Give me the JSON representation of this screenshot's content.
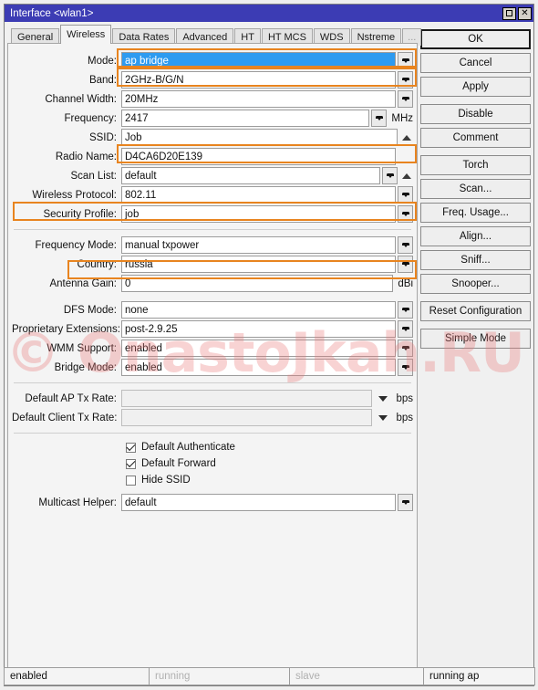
{
  "window": {
    "title": "Interface <wlan1>",
    "maximize_label": "maximize",
    "close_label": "✕",
    "titlebar_color": "#3c3cb4",
    "highlight_color": "#e8841f",
    "selection_color": "#2e9bf0"
  },
  "tabs": [
    {
      "label": "General",
      "active": false
    },
    {
      "label": "Wireless",
      "active": true
    },
    {
      "label": "Data Rates",
      "active": false
    },
    {
      "label": "Advanced",
      "active": false
    },
    {
      "label": "HT",
      "active": false
    },
    {
      "label": "HT MCS",
      "active": false
    },
    {
      "label": "WDS",
      "active": false
    },
    {
      "label": "Nstreme",
      "active": false
    },
    {
      "label": "...",
      "active": false
    }
  ],
  "fields": {
    "mode": {
      "label": "Mode:",
      "value": "ap bridge"
    },
    "band": {
      "label": "Band:",
      "value": "2GHz-B/G/N"
    },
    "channel_width": {
      "label": "Channel Width:",
      "value": "20MHz"
    },
    "frequency": {
      "label": "Frequency:",
      "value": "2417",
      "suffix": "MHz"
    },
    "ssid": {
      "label": "SSID:",
      "value": "Job"
    },
    "radio_name": {
      "label": "Radio Name:",
      "value": "D4CA6D20E139"
    },
    "scan_list": {
      "label": "Scan List:",
      "value": "default"
    },
    "wireless_protocol": {
      "label": "Wireless Protocol:",
      "value": "802.11"
    },
    "security_profile": {
      "label": "Security Profile:",
      "value": "job"
    },
    "frequency_mode": {
      "label": "Frequency Mode:",
      "value": "manual txpower"
    },
    "country": {
      "label": "Country:",
      "value": "russia"
    },
    "antenna_gain": {
      "label": "Antenna Gain:",
      "value": "0",
      "suffix": "dBi"
    },
    "dfs_mode": {
      "label": "DFS Mode:",
      "value": "none"
    },
    "proprietary_extensions": {
      "label": "Proprietary Extensions:",
      "value": "post-2.9.25"
    },
    "wmm_support": {
      "label": "WMM Support:",
      "value": "enabled"
    },
    "bridge_mode": {
      "label": "Bridge Mode:",
      "value": "enabled"
    },
    "default_ap_tx_rate": {
      "label": "Default AP Tx Rate:",
      "value": "",
      "suffix": "bps"
    },
    "default_client_tx_rate": {
      "label": "Default Client Tx Rate:",
      "value": "",
      "suffix": "bps"
    },
    "multicast_helper": {
      "label": "Multicast Helper:",
      "value": "default"
    }
  },
  "checkboxes": [
    {
      "label": "Default Authenticate",
      "checked": true
    },
    {
      "label": "Default Forward",
      "checked": true
    },
    {
      "label": "Hide SSID",
      "checked": false
    }
  ],
  "buttons": [
    {
      "label": "OK"
    },
    {
      "label": "Cancel"
    },
    {
      "label": "Apply"
    },
    {
      "label": "Disable"
    },
    {
      "label": "Comment"
    },
    {
      "label": "Torch"
    },
    {
      "label": "Scan..."
    },
    {
      "label": "Freq. Usage..."
    },
    {
      "label": "Align..."
    },
    {
      "label": "Sniff..."
    },
    {
      "label": "Snooper..."
    },
    {
      "label": "Reset Configuration"
    },
    {
      "label": "Simple Mode"
    }
  ],
  "statusbar": [
    {
      "label": "enabled",
      "dim": false
    },
    {
      "label": "running",
      "dim": true
    },
    {
      "label": "slave",
      "dim": true
    },
    {
      "label": "running ap",
      "dim": false
    }
  ],
  "watermark": {
    "text": "© OnastoJkah.RU"
  }
}
